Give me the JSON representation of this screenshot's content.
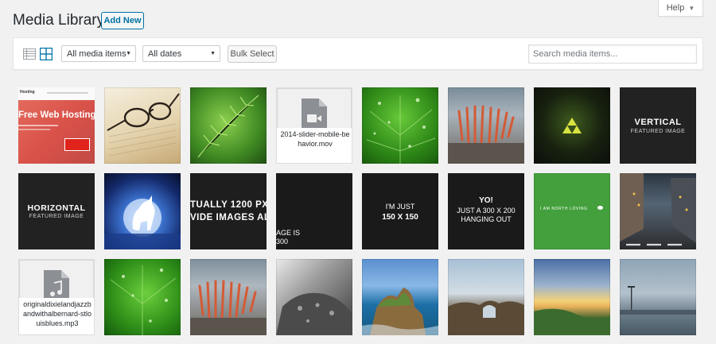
{
  "help": {
    "label": "Help"
  },
  "header": {
    "title": "Media Library",
    "add_new": "Add New"
  },
  "toolbar": {
    "filter_type": "All media items",
    "filter_date": "All dates",
    "bulk_select": "Bulk Select",
    "search_placeholder": "Search media items..."
  },
  "tiles": {
    "web_hosting": {
      "logo": "Hosting",
      "headline": "Free Web Hosting"
    },
    "file_mov": {
      "name": "2014-slider-mobile-behavior.mov"
    },
    "vertical": {
      "big": "VERTICAL",
      "small": "FEATURED IMAGE"
    },
    "horizontal": {
      "big": "HORIZONTAL",
      "small": "FEATURED IMAGE"
    },
    "wide": {
      "line1": "TUALLY 1200 PX",
      "line2": "VIDE IMAGES ALV"
    },
    "age": {
      "line1": "AGE IS",
      "line2": "300"
    },
    "just150": {
      "line1": "I'M JUST",
      "line2": "150 X 150"
    },
    "yo": {
      "line1": "YO!",
      "line2": "JUST A 300 X 200",
      "line3": "HANGING OUT"
    },
    "north": {
      "text": "I AM NORTH LOVING"
    },
    "file_mp3": {
      "name": "originaldixielandjazzbandwithalbernard-stlouisblues.mp3"
    }
  }
}
